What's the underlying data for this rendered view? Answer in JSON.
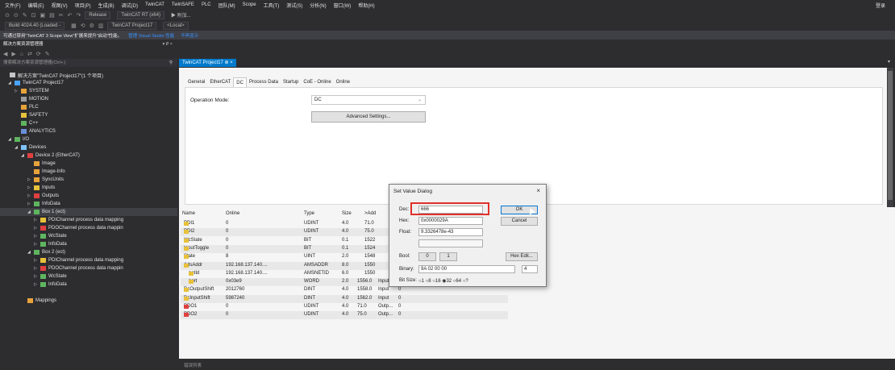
{
  "menu": {
    "items": [
      "文件(F)",
      "编辑(E)",
      "视图(V)",
      "项目(P)",
      "生成(B)",
      "调试(D)",
      "TwinCAT",
      "TwinSAFE",
      "PLC",
      "团队(M)",
      "Scope",
      "工具(T)",
      "测试(S)",
      "分析(N)",
      "窗口(W)",
      "帮助(H)"
    ],
    "login": "登录"
  },
  "toolbar1": {
    "config": "Release",
    "platform": "TwinCAT RT (x64)",
    "attach": "▶ 附加..."
  },
  "toolbar2": {
    "build": "Build 4024.40 (Loaded -",
    "project": "TwinCAT Project17",
    "target": "<Local>"
  },
  "infobar": {
    "message": "可通过禁用\"TwinCAT 3 Scope View\"扩展来提升\"启动\"性能。",
    "manage": "管理 Visual Studio 性能",
    "dismiss": "不再显示"
  },
  "solution": {
    "title": "解决方案资源管理器",
    "controls": "▾ ₽ ×",
    "search_placeholder": "搜索解决方案资源管理器(Ctrl+;)",
    "nodes": [
      {
        "label": "解决方案\"TwinCAT Project17\"(1 个项目)",
        "arrow": "",
        "icon": "solution",
        "color": "#c5c5c5"
      },
      {
        "label": "TwinCAT Project17",
        "arrow": "◢",
        "icon": "project",
        "color": "#4aa3ff"
      },
      {
        "label": "SYSTEM",
        "arrow": "▷",
        "icon": "folder",
        "color": "#e8a33b"
      },
      {
        "label": "MOTION",
        "arrow": "",
        "icon": "folder",
        "color": "#9c9c9c"
      },
      {
        "label": "PLC",
        "arrow": "",
        "icon": "folder",
        "color": "#e8a33b"
      },
      {
        "label": "SAFETY",
        "arrow": "",
        "icon": "folder",
        "color": "#e8c13b"
      },
      {
        "label": "C++",
        "arrow": "",
        "icon": "folder",
        "color": "#5fb55f"
      },
      {
        "label": "ANALYTICS",
        "arrow": "",
        "icon": "folder",
        "color": "#6a8fd8"
      },
      {
        "label": "I/O",
        "arrow": "◢",
        "icon": "folder",
        "color": "#5fb55f"
      },
      {
        "label": "Devices",
        "arrow": "◢",
        "icon": "devices",
        "color": "#7ec4ff"
      },
      {
        "label": "Device 2 (EtherCAT)",
        "arrow": "◢",
        "icon": "device",
        "color": "#e04040"
      },
      {
        "label": "Image",
        "arrow": "",
        "icon": "grid",
        "color": "#e8a33b"
      },
      {
        "label": "Image-Info",
        "arrow": "",
        "icon": "grid",
        "color": "#e8a33b"
      },
      {
        "label": "SyncUnits",
        "arrow": "▷",
        "icon": "sync",
        "color": "#e8a33b"
      },
      {
        "label": "Inputs",
        "arrow": "▷",
        "icon": "in",
        "color": "#e8c13b"
      },
      {
        "label": "Outputs",
        "arrow": "▷",
        "icon": "out",
        "color": "#e04040"
      },
      {
        "label": "InfoData",
        "arrow": "▷",
        "icon": "info",
        "color": "#5fb55f"
      },
      {
        "label": "Box 1 (ect)",
        "arrow": "◢",
        "icon": "box",
        "color": "#5fb55f"
      },
      {
        "label": "PDIChannel process data mapping",
        "arrow": "▷",
        "icon": "in",
        "color": "#e8c13b"
      },
      {
        "label": "PDOChannel process data mappin",
        "arrow": "▷",
        "icon": "out",
        "color": "#e04040"
      },
      {
        "label": "WcState",
        "arrow": "▷",
        "icon": "info",
        "color": "#5fb55f"
      },
      {
        "label": "InfoData",
        "arrow": "▷",
        "icon": "info",
        "color": "#5fb55f"
      },
      {
        "label": "Box 2 (ect)",
        "arrow": "◢",
        "icon": "box",
        "color": "#5fb55f"
      },
      {
        "label": "PDIChannel process data mapping",
        "arrow": "▷",
        "icon": "in",
        "color": "#e8c13b"
      },
      {
        "label": "PDOChannel process data mappin",
        "arrow": "▷",
        "icon": "out",
        "color": "#e04040"
      },
      {
        "label": "WcState",
        "arrow": "▷",
        "icon": "info",
        "color": "#5fb55f"
      },
      {
        "label": "InfoData",
        "arrow": "▷",
        "icon": "info",
        "color": "#5fb55f"
      },
      {
        "label": "Mappings",
        "arrow": "",
        "icon": "grid",
        "color": "#e8a33b"
      }
    ]
  },
  "doc_tab": {
    "label": "TwinCAT Project17",
    "pin": "⊕",
    "close": "×"
  },
  "inner_tabs": [
    "General",
    "EtherCAT",
    "DC",
    "Process Data",
    "Startup",
    "CoE - Online",
    "Online"
  ],
  "dc": {
    "operation_mode_label": "Operation Mode:",
    "operation_mode_value": "DC",
    "advanced_button": "Advanced Settings..."
  },
  "variables": {
    "headers": [
      "Name",
      "Online",
      "Type",
      "Size",
      ">Add"
    ],
    "rows": [
      {
        "name": "PDI1",
        "online": "0",
        "type": "UDINT",
        "size": "4.0",
        "addr": "71.0",
        "dir": "",
        "val": "",
        "icon": "#e8c13b"
      },
      {
        "name": "PDI2",
        "online": "0",
        "type": "UDINT",
        "size": "4.0",
        "addr": "75.0",
        "dir": "",
        "val": "",
        "icon": "#e8c13b"
      },
      {
        "name": "WcState",
        "online": "0",
        "type": "BIT",
        "size": "0.1",
        "addr": "1522",
        "dir": "",
        "val": "",
        "icon": "#e8c13b"
      },
      {
        "name": "InputToggle",
        "online": "0",
        "type": "BIT",
        "size": "0.1",
        "addr": "1524",
        "dir": "",
        "val": "",
        "icon": "#e8c13b"
      },
      {
        "name": "State",
        "online": "8",
        "type": "UINT",
        "size": "2.0",
        "addr": "1548",
        "dir": "",
        "val": "",
        "icon": "#e8c13b"
      },
      {
        "name": "AdsAddr",
        "online": "192.168.137.140....",
        "type": "AMSADDR",
        "size": "8.0",
        "addr": "1550",
        "dir": "",
        "val": "",
        "icon": "#e8c13b"
      },
      {
        "name": "netId",
        "online": "192.168.137.140....",
        "type": "AMSNETID",
        "size": "6.0",
        "addr": "1550",
        "dir": "",
        "val": "",
        "icon": "#e8c13b"
      },
      {
        "name": "port",
        "online": "0x03e9",
        "type": "WORD",
        "size": "2.0",
        "addr": "1556.0",
        "dir": "Input",
        "val": "0",
        "icon": "#e8c13b"
      },
      {
        "name": "DcOutputShift",
        "online": "2012760",
        "type": "DINT",
        "size": "4.0",
        "addr": "1558.0",
        "dir": "Input",
        "val": "0",
        "icon": "#e8c13b"
      },
      {
        "name": "DcInputShift",
        "online": "5987240",
        "type": "DINT",
        "size": "4.0",
        "addr": "1562.0",
        "dir": "Input",
        "val": "0",
        "icon": "#e8c13b"
      },
      {
        "name": "PDO1",
        "online": "0",
        "type": "UDINT",
        "size": "4.0",
        "addr": "71.0",
        "dir": "Outp...",
        "val": "0",
        "icon": "#e04040"
      },
      {
        "name": "PDO2",
        "online": "0",
        "type": "UDINT",
        "size": "4.0",
        "addr": "75.0",
        "dir": "Outp...",
        "val": "0",
        "icon": "#e04040"
      }
    ]
  },
  "dialog": {
    "title": "Set Value Dialog",
    "close": "×",
    "dec_label": "Dec:",
    "dec_value": "666",
    "hex_label": "Hex:",
    "hex_value": "0x0000029A",
    "float_label": "Float:",
    "float_value": "9.3326478e-43",
    "ok": "OK",
    "cancel": "Cancel",
    "bool_label": "Bool:",
    "bool_0": "0",
    "bool_1": "1",
    "hex_edit": "Hex Edit...",
    "binary_label": "Binary:",
    "binary_value": "9A 02 00 00",
    "binary_len": "4",
    "bitsize_label": "Bit Size:",
    "bitsize_options": "○1  ○8  ○16  ◉32  ○64  ○?"
  },
  "statusbar": {
    "text": "错误列表"
  }
}
